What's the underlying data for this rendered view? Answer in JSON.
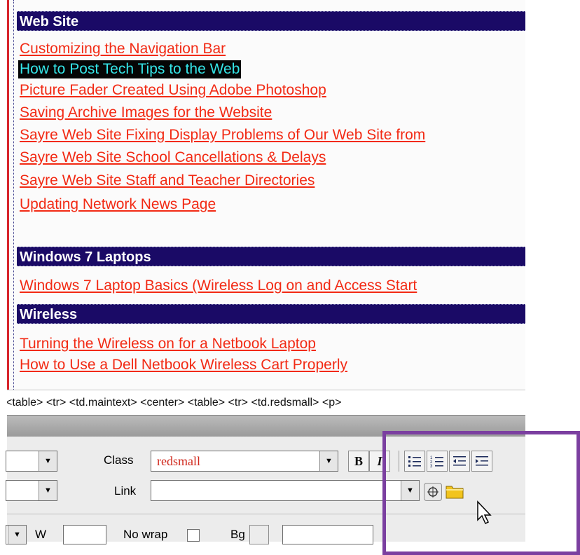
{
  "sections": [
    {
      "title": "Web Site",
      "links": [
        "Customizing the Navigation Bar",
        "How to Post Tech Tips to the Web",
        "Picture Fader Created Using Adobe Photoshop",
        "Saving Archive Images for the Website",
        "Sayre Web Site Fixing Display Problems of Our Web Site from",
        "Sayre Web Site School Cancellations & Delays",
        "Sayre Web Site Staff and Teacher Directories",
        "Updating Network News Page"
      ]
    },
    {
      "title": "Windows 7 Laptops",
      "links": [
        "Windows 7 Laptop Basics (Wireless Log on and Access Start"
      ]
    },
    {
      "title": "Wireless",
      "links": [
        "Turning the Wireless on for a Netbook Laptop",
        "How to Use a Dell Netbook Wireless Cart Properly"
      ]
    }
  ],
  "selected_link": "How to Post Tech Tips to the Web",
  "tag_selector": "<table> <tr> <td.maintext> <center> <table> <tr> <td.redsmall> <p>",
  "properties": {
    "class_label": "Class",
    "class_value": "redsmall",
    "link_label": "Link",
    "link_value": "",
    "bold_label": "B",
    "italic_label": "I",
    "w_label": "W",
    "nowrap_label": "No wrap",
    "bg_label": "Bg"
  },
  "colors": {
    "category_bg": "#1a0a66",
    "link": "#f22a14",
    "selection_bg": "#050505",
    "selection_text": "#35e5e8",
    "highlight_box": "#7b3fa0"
  },
  "icons": {
    "unordered_list": "unordered-list-icon",
    "ordered_list": "ordered-list-icon",
    "outdent": "outdent-icon",
    "indent": "indent-icon",
    "point_to_file": "point-to-file-icon",
    "browse_folder": "folder-icon",
    "cursor": "mouse-pointer-icon"
  }
}
